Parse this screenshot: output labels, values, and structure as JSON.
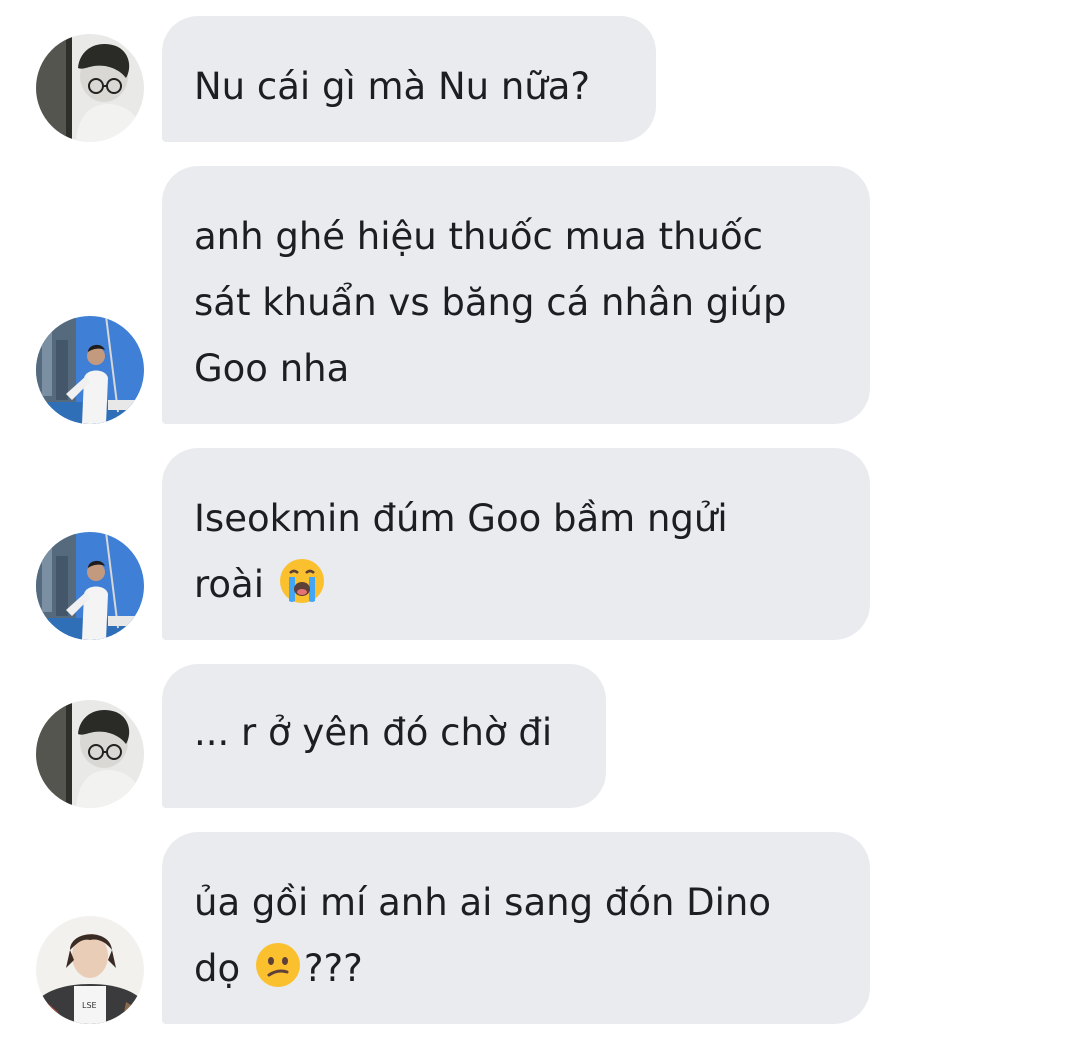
{
  "messages": [
    {
      "sender_avatar": "avatar-bw-glasses",
      "lines": [
        "Nu cái gì mà Nu nữa?"
      ]
    },
    {
      "sender_avatar": "avatar-boat-photo",
      "lines": [
        "anh ghé hiệu thuốc mua thuốc",
        "sát khuẩn vs băng cá nhân giúp",
        "Goo nha"
      ]
    },
    {
      "sender_avatar": "avatar-boat-photo",
      "lines": [
        "Iseokmin đúm Goo bầm ngửi"
      ],
      "last_line": "roài",
      "emoji": "loudly-crying-face-emoji"
    },
    {
      "sender_avatar": "avatar-bw-glasses",
      "lines": [
        "... r ở yên đó chờ đi"
      ]
    },
    {
      "sender_avatar": "avatar-patterned-jacket",
      "lines": [
        "ủa gồi mí anh ai sang đón Dino"
      ],
      "last_line_before": "dọ",
      "emoji": "confused-face-emoji",
      "last_line_after": "???"
    }
  ],
  "colors": {
    "bubble_background": "#e9ebef",
    "text": "#1c1e21",
    "page_background": "#ffffff"
  }
}
